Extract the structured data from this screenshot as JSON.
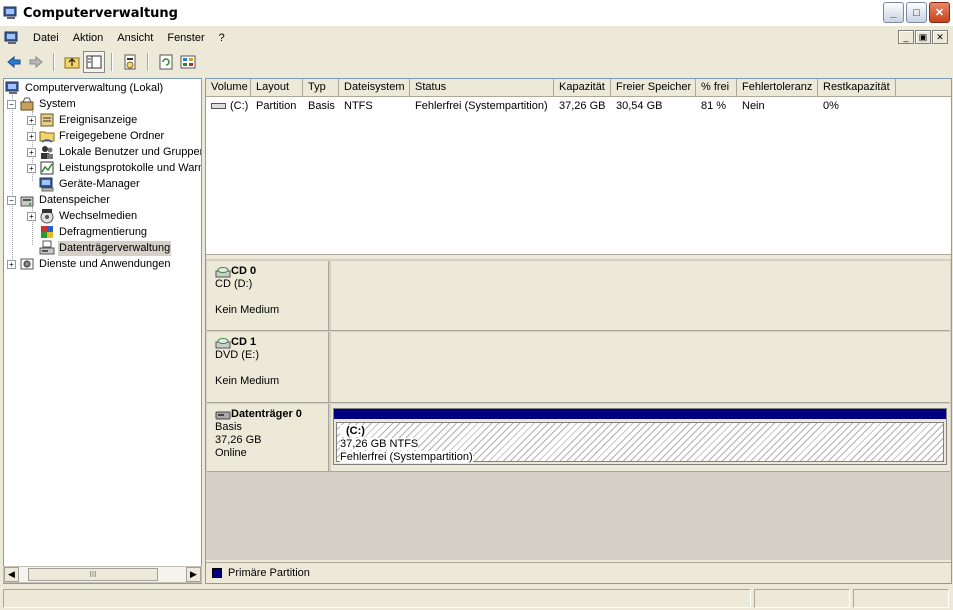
{
  "window": {
    "title": "Computerverwaltung",
    "controls": {
      "minimize": "_",
      "maximize": "□",
      "close": "✕"
    }
  },
  "menubar": {
    "items": [
      "Datei",
      "Aktion",
      "Ansicht",
      "Fenster",
      "?"
    ],
    "mdi_controls": [
      "_",
      "▣",
      "✕"
    ]
  },
  "toolbar": {
    "buttons": [
      "back-icon",
      "forward-icon",
      "up-folder-icon",
      "show-hide-tree-icon",
      "properties-icon",
      "refresh-icon",
      "help-icon"
    ]
  },
  "tree": {
    "root": "Computerverwaltung (Lokal)",
    "system": "System",
    "event_viewer": "Ereignisanzeige",
    "shared_folders": "Freigegebene Ordner",
    "local_users": "Lokale Benutzer und Gruppen",
    "perf_logs": "Leistungsprotokolle und Warnungen",
    "device_manager": "Geräte-Manager",
    "storage": "Datenspeicher",
    "removable": "Wechselmedien",
    "defrag": "Defragmentierung",
    "disk_mgmt": "Datenträgerverwaltung",
    "services": "Dienste und Anwendungen",
    "scroll_thumb": "III"
  },
  "volume_list": {
    "columns": [
      "Volume",
      "Layout",
      "Typ",
      "Dateisystem",
      "Status",
      "Kapazität",
      "Freier Speicher",
      "% frei",
      "Fehlertoleranz",
      "Restkapazität"
    ],
    "rows": [
      {
        "volume": "(C:)",
        "layout": "Partition",
        "typ": "Basis",
        "dateisystem": "NTFS",
        "status": "Fehlerfrei (Systempartition)",
        "kapazitaet": "37,26 GB",
        "freier_speicher": "30,54 GB",
        "prozent_frei": "81 %",
        "fehlertoleranz": "Nein",
        "restkapazitaet": "0%"
      }
    ]
  },
  "disks": {
    "cd0": {
      "name": "CD 0",
      "drive": "CD (D:)",
      "status": "Kein Medium"
    },
    "cd1": {
      "name": "CD 1",
      "drive": "DVD (E:)",
      "status": "Kein Medium"
    },
    "disk0": {
      "name": "Datenträger 0",
      "type": "Basis",
      "size": "37,26 GB",
      "state": "Online",
      "partition": {
        "name": "(C:)",
        "size_fs": "37,26 GB NTFS",
        "status": "Fehlerfrei (Systempartition)",
        "color": "#000080"
      }
    }
  },
  "legend": {
    "label": "Primäre Partition",
    "color": "#000080"
  }
}
